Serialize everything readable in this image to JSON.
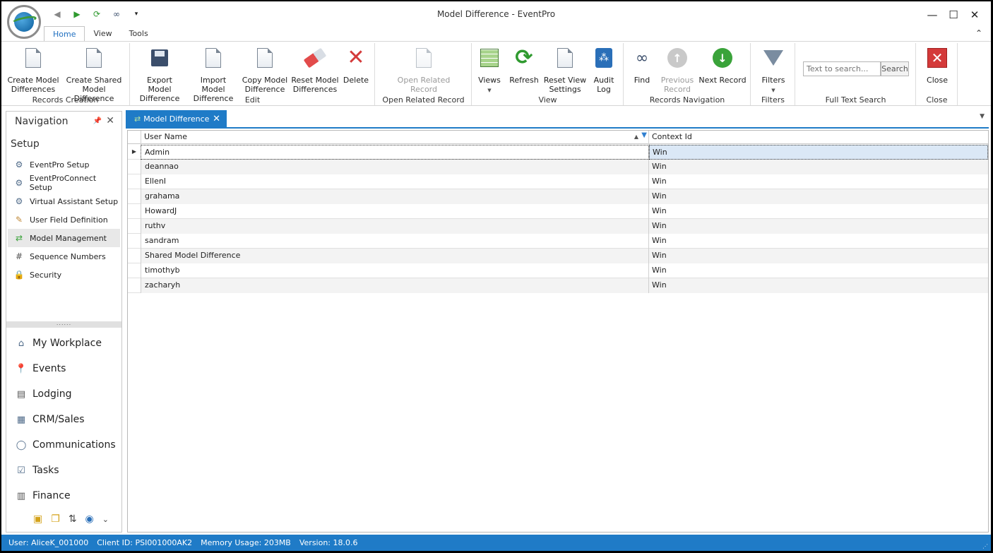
{
  "window": {
    "title": "Model Difference - EventPro",
    "minimize": "—",
    "maximize": "☐",
    "close": "✕"
  },
  "qat": {
    "back": "◀",
    "forward": "▶",
    "refresh": "⟳",
    "find": "∞",
    "customize": "▾"
  },
  "ribbon_tabs": [
    "Home",
    "View",
    "Tools"
  ],
  "ribbon": {
    "collapse": "⌃",
    "groups": {
      "records_creation": {
        "label": "Records Creation",
        "create_model": "Create Model Differences",
        "create_shared": "Create Shared Model Difference"
      },
      "edit": {
        "label": "Edit",
        "export": "Export Model Difference",
        "import": "Import Model Difference",
        "copy": "Copy Model Difference",
        "reset": "Reset Model Differences",
        "delete": "Delete"
      },
      "open_related": {
        "label": "Open Related Record",
        "open": "Open Related Record"
      },
      "view": {
        "label": "View",
        "views": "Views",
        "refresh": "Refresh",
        "reset_view": "Reset View Settings",
        "audit": "Audit Log"
      },
      "records_nav": {
        "label": "Records Navigation",
        "find": "Find",
        "previous": "Previous Record",
        "next": "Next Record"
      },
      "filters": {
        "label": "Filters",
        "filters": "Filters"
      },
      "full_text": {
        "label": "Full Text Search",
        "placeholder": "Text to search...",
        "search": "Search"
      },
      "close": {
        "label": "Close",
        "close": "Close"
      }
    }
  },
  "navigation": {
    "title": "Navigation",
    "section": "Setup",
    "setup_items": [
      {
        "label": "EventPro Setup",
        "icon": "gear-icon"
      },
      {
        "label": "EventProConnect Setup",
        "icon": "gear-icon"
      },
      {
        "label": "Virtual Assistant Setup",
        "icon": "gear-icon"
      },
      {
        "label": "User Field Definition",
        "icon": "user-field-icon"
      },
      {
        "label": "Model Management",
        "icon": "model-icon"
      },
      {
        "label": "Sequence Numbers",
        "icon": "hash-icon"
      },
      {
        "label": "Security",
        "icon": "lock-icon"
      }
    ],
    "splitter": "......",
    "modules": [
      {
        "label": "My Workplace",
        "icon": "home-icon"
      },
      {
        "label": "Events",
        "icon": "pin-icon"
      },
      {
        "label": "Lodging",
        "icon": "lodging-icon"
      },
      {
        "label": "CRM/Sales",
        "icon": "crm-icon"
      },
      {
        "label": "Communications",
        "icon": "speech-icon"
      },
      {
        "label": "Tasks",
        "icon": "clipboard-icon"
      },
      {
        "label": "Finance",
        "icon": "calculator-icon"
      }
    ]
  },
  "document": {
    "tab_label": "Model Difference",
    "columns": [
      "User Name",
      "Context Id"
    ],
    "rows": [
      {
        "user": "Admin",
        "context": "Win"
      },
      {
        "user": "deannao",
        "context": "Win"
      },
      {
        "user": "EllenI",
        "context": "Win"
      },
      {
        "user": "grahama",
        "context": "Win"
      },
      {
        "user": "HowardJ",
        "context": "Win"
      },
      {
        "user": "ruthv",
        "context": "Win"
      },
      {
        "user": "sandram",
        "context": "Win"
      },
      {
        "user": "Shared Model Difference",
        "context": "Win"
      },
      {
        "user": "timothyb",
        "context": "Win"
      },
      {
        "user": "zacharyh",
        "context": "Win"
      }
    ]
  },
  "status": {
    "user": "User: AliceK_001000",
    "client": "Client ID: PSI001000AK2",
    "memory": "Memory Usage: 203MB",
    "version": "Version: 18.0.6"
  },
  "colors": {
    "accent": "#1f7bc7",
    "selected_row": "#dbe8f6"
  }
}
